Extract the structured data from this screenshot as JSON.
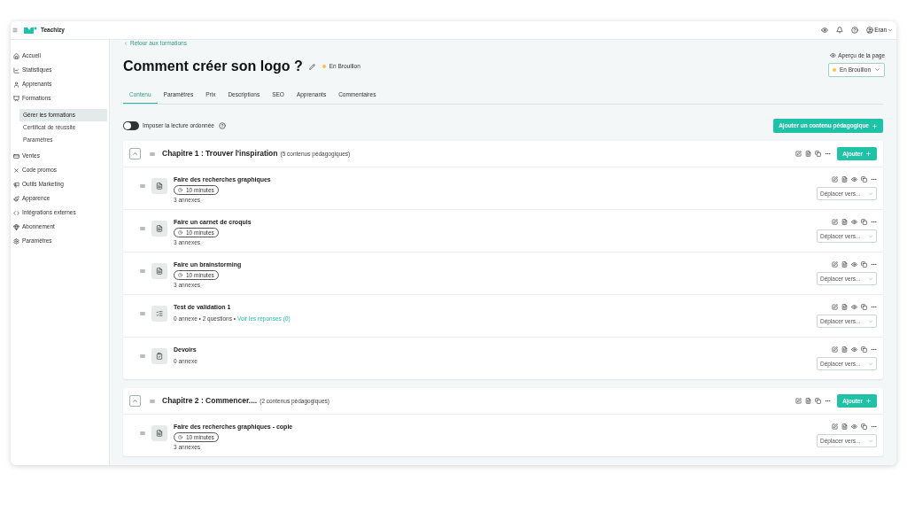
{
  "app": {
    "name": "Teachizy"
  },
  "top_bar": {
    "user": "Eran"
  },
  "sidebar": {
    "items": [
      {
        "label": "Accueil",
        "selected": false
      },
      {
        "label": "Statistiques",
        "selected": false
      },
      {
        "label": "Apprenants",
        "selected": false
      },
      {
        "label": "Formations",
        "selected": false,
        "children": [
          {
            "label": "Gérer les formations",
            "selected": true
          },
          {
            "label": "Certificat de réussite",
            "selected": false
          },
          {
            "label": "Paramètres",
            "selected": false
          }
        ]
      },
      {
        "label": "Ventes",
        "selected": false
      },
      {
        "label": "Code promos",
        "selected": false
      },
      {
        "label": "Outils Marketing",
        "selected": false
      },
      {
        "label": "Apparence",
        "selected": false
      },
      {
        "label": "Intégrations externes",
        "selected": false
      },
      {
        "label": "Abonnement",
        "selected": false
      },
      {
        "label": "Paramètres",
        "selected": false
      }
    ]
  },
  "back_link": "Retour aux formations",
  "page": {
    "title": "Comment créer son logo ?",
    "status": "En Brouillon"
  },
  "preview_link": "Aperçu de la page",
  "status_select": {
    "value": "En Brouillon"
  },
  "tabs": [
    {
      "label": "Contenu",
      "selected": true
    },
    {
      "label": "Paramètres",
      "selected": false
    },
    {
      "label": "Prix",
      "selected": false
    },
    {
      "label": "Descriptions",
      "selected": false
    },
    {
      "label": "SEO",
      "selected": false
    },
    {
      "label": "Apprenants",
      "selected": false
    },
    {
      "label": "Commentaires",
      "selected": false
    }
  ],
  "ordered_reading": {
    "label": "Imposer la lecture ordonnée",
    "on": false
  },
  "add_content_button": "Ajouter un contenu pédagogique",
  "chapters": [
    {
      "title": "Chapitre 1 : Trouver l'inspiration",
      "count": "(5 contenus pédagogiques)",
      "expanded": true,
      "add_button": "Ajouter",
      "items": [
        {
          "kind": "lesson",
          "title": "Faire des recherches graphiques",
          "duration": "10 minutes",
          "meta": "3 annexes",
          "move_select": "Déplacer vers..."
        },
        {
          "kind": "lesson",
          "title": "Faire un carnet de croquis",
          "duration": "10 minutes",
          "meta": "3 annexes",
          "move_select": "Déplacer vers..."
        },
        {
          "kind": "lesson",
          "title": "Faire un brainstorming",
          "duration": "10 minutes",
          "meta": "3 annexes",
          "move_select": "Déplacer vers..."
        },
        {
          "kind": "quiz",
          "title": "Test de validation 1",
          "meta": "0 annexe • 2 questions •",
          "link": "Voir les réponses (0)",
          "move_select": "Déplacer vers..."
        },
        {
          "kind": "assignment",
          "title": "Devoirs",
          "meta": "0 annexe",
          "move_select": "Déplacer vers..."
        }
      ]
    },
    {
      "title": "Chapitre 2 : Commencer....",
      "count": "(2 contenus pédagogiques)",
      "expanded": true,
      "add_button": "Ajouter",
      "items": [
        {
          "kind": "lesson",
          "title": "Faire des recherches graphiques - copie",
          "duration": "10 minutes",
          "meta": "3 annexes",
          "move_select": "Déplacer vers..."
        }
      ]
    }
  ]
}
